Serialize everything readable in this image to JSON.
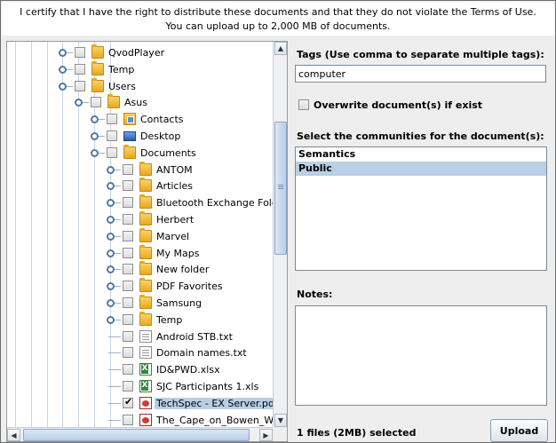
{
  "header": {
    "line1": "I certify that I have the right to distribute these documents and that they do not violate the Terms of Use.",
    "line2": "You can upload up to 2,000 MB of documents."
  },
  "tree": {
    "nodes": [
      {
        "label": "QvodPlayer",
        "icon": "folder-icon",
        "expander": true,
        "checked": false
      },
      {
        "label": "Temp",
        "icon": "folder-icon",
        "expander": true,
        "checked": false
      },
      {
        "label": "Users",
        "icon": "folder-icon",
        "expander": true,
        "checked": false
      },
      {
        "label": "Asus",
        "icon": "folder-icon",
        "expander": true,
        "checked": false
      },
      {
        "label": "Contacts",
        "icon": "contacts-folder-icon",
        "expander": true,
        "checked": false
      },
      {
        "label": "Desktop",
        "icon": "desktop-icon",
        "expander": true,
        "checked": false
      },
      {
        "label": "Documents",
        "icon": "documents-folder-icon",
        "expander": true,
        "checked": false
      },
      {
        "label": "ANTOM",
        "icon": "folder-icon",
        "expander": true,
        "checked": false
      },
      {
        "label": "Articles",
        "icon": "folder-icon",
        "expander": true,
        "checked": false
      },
      {
        "label": "Bluetooth Exchange Folder",
        "icon": "folder-icon",
        "expander": true,
        "checked": false
      },
      {
        "label": "Herbert",
        "icon": "folder-icon",
        "expander": true,
        "checked": false
      },
      {
        "label": "Marvel",
        "icon": "folder-icon",
        "expander": true,
        "checked": false
      },
      {
        "label": "My Maps",
        "icon": "folder-icon",
        "expander": true,
        "checked": false
      },
      {
        "label": "New folder",
        "icon": "folder-icon",
        "expander": true,
        "checked": false
      },
      {
        "label": "PDF Favorites",
        "icon": "folder-icon",
        "expander": true,
        "checked": false
      },
      {
        "label": "Samsung",
        "icon": "folder-icon",
        "expander": true,
        "checked": false
      },
      {
        "label": "Temp",
        "icon": "folder-icon",
        "expander": true,
        "checked": false
      },
      {
        "label": "Android STB.txt",
        "icon": "text-file-icon",
        "expander": false,
        "checked": false
      },
      {
        "label": "Domain names.txt",
        "icon": "text-file-icon",
        "expander": false,
        "checked": false
      },
      {
        "label": "ID&PWD.xlsx",
        "icon": "excel-file-icon",
        "expander": false,
        "checked": false
      },
      {
        "label": "SJC Participants 1.xls",
        "icon": "excel-file-icon",
        "expander": false,
        "checked": false
      },
      {
        "label": "TechSpec - EX Server.pdf",
        "icon": "pdf-file-icon",
        "expander": false,
        "checked": true,
        "selected": true
      },
      {
        "label": "The_Cape_on_Bowen_Wo",
        "icon": "pdf-file-icon",
        "expander": false,
        "checked": false
      }
    ]
  },
  "tags": {
    "label": "Tags (Use comma to separate multiple tags):",
    "value": "computer"
  },
  "overwrite": {
    "label": "Overwrite document(s) if exist",
    "checked": false
  },
  "communities": {
    "label": "Select the communities for the document(s):",
    "items": [
      {
        "name": "Semantics",
        "selected": false
      },
      {
        "name": "Public",
        "selected": true
      }
    ]
  },
  "notes": {
    "label": "Notes:",
    "value": ""
  },
  "status": "1 files (2MB) selected",
  "upload_label": "Upload"
}
